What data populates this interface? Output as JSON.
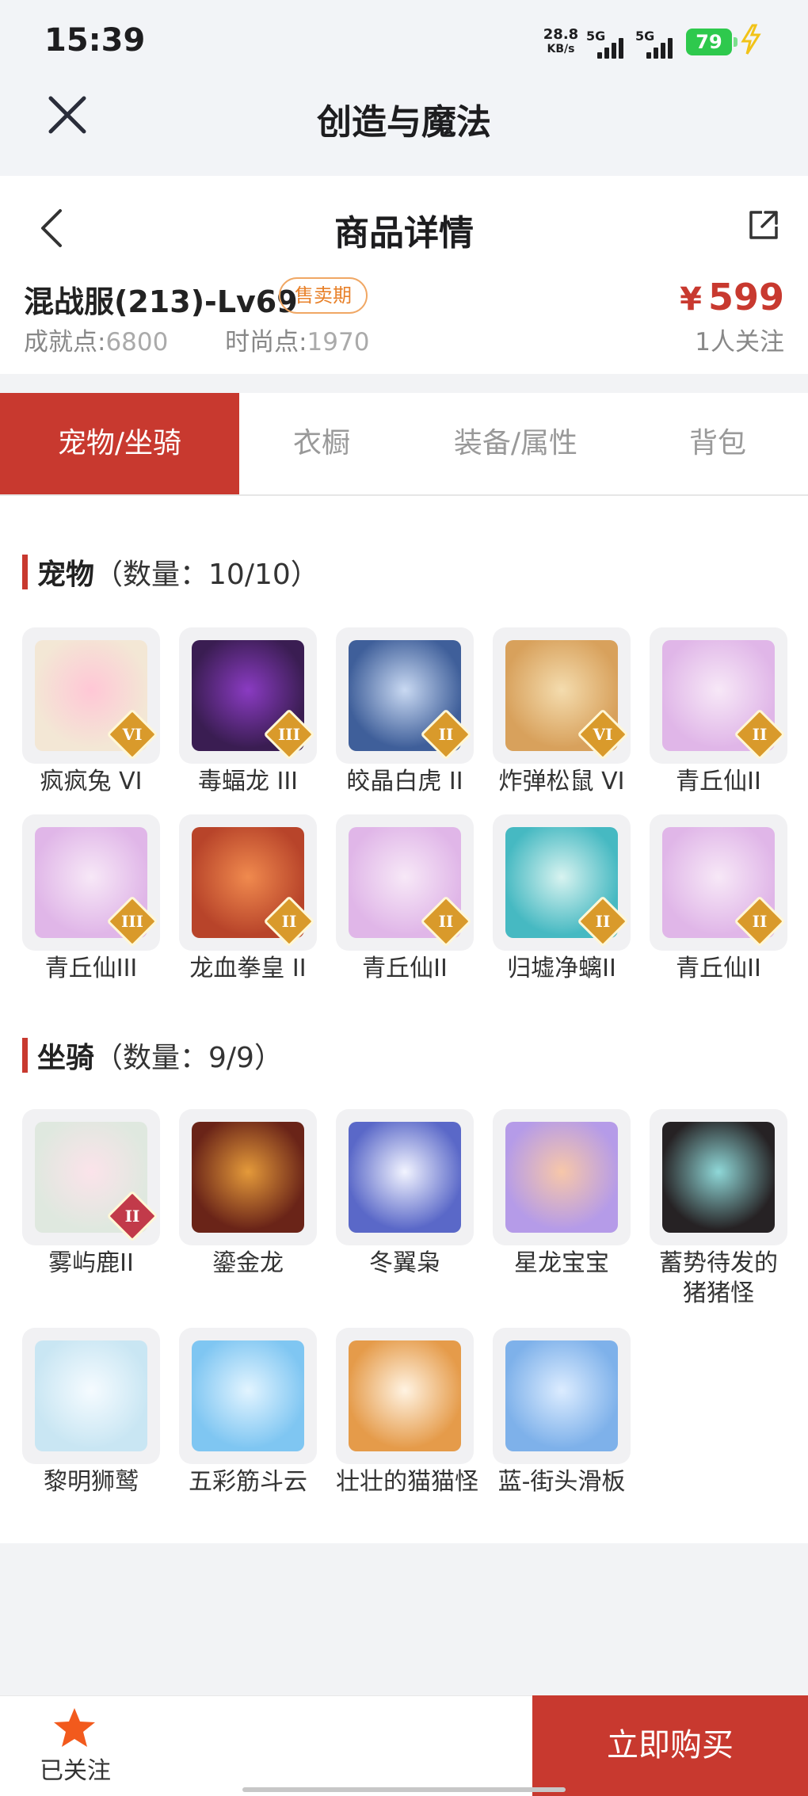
{
  "status_bar": {
    "time": "15:39",
    "net_speed_value": "28.8",
    "net_speed_unit": "KB/s",
    "signal1_label": "5G",
    "signal2_label": "5G",
    "battery": "79"
  },
  "app_bar": {
    "title": "创造与魔法"
  },
  "header": {
    "title": "商品详情"
  },
  "product": {
    "server": "混战服(213)-Lv69",
    "badge": "售卖期",
    "price_symbol": "¥",
    "price": "599",
    "followers": "1人关注",
    "achievement_label": "成就点:",
    "achievement_value": "6800",
    "fashion_label": "时尚点:",
    "fashion_value": "1970"
  },
  "tabs": [
    {
      "label": "宠物/坐骑",
      "active": true
    },
    {
      "label": "衣橱",
      "active": false
    },
    {
      "label": "装备/属性",
      "active": false
    },
    {
      "label": "背包",
      "active": false
    }
  ],
  "pets_section": {
    "title": "宠物",
    "count": "（数量：10/10）"
  },
  "pets": [
    {
      "name": "疯疯兔 VI",
      "level": "VI",
      "icon": "bunny-icon",
      "color": "#f3e7d5",
      "color2": "#ffc7d6"
    },
    {
      "name": "毒蝠龙 III",
      "level": "III",
      "icon": "bat-dragon-icon",
      "color": "#3a1d52",
      "color2": "#8a3bc2"
    },
    {
      "name": "皎晶白虎 II",
      "level": "II",
      "icon": "white-tiger-icon",
      "color": "#3f5f9a",
      "color2": "#c9d9f2"
    },
    {
      "name": "炸弹松鼠 VI",
      "level": "VI",
      "icon": "squirrel-icon",
      "color": "#d8a15c",
      "color2": "#f4dcae"
    },
    {
      "name": "青丘仙II",
      "level": "II",
      "icon": "fox-fairy-icon",
      "color": "#e0b6e8",
      "color2": "#f7e8f7"
    },
    {
      "name": "青丘仙III",
      "level": "III",
      "icon": "fox-fairy-icon",
      "color": "#e0b6e8",
      "color2": "#f7e8f7"
    },
    {
      "name": "龙血拳皇 II",
      "level": "II",
      "icon": "dragon-fist-icon",
      "color": "#b8442a",
      "color2": "#f08a4e"
    },
    {
      "name": "青丘仙II",
      "level": "II",
      "icon": "fox-fairy-icon",
      "color": "#e0b6e8",
      "color2": "#f7e8f7"
    },
    {
      "name": "归墟净螭II",
      "level": "II",
      "icon": "water-dragon-icon",
      "color": "#46b9c2",
      "color2": "#d8f3f0"
    },
    {
      "name": "青丘仙II",
      "level": "II",
      "icon": "fox-fairy-icon",
      "color": "#e0b6e8",
      "color2": "#f7e8f7"
    }
  ],
  "mounts_section": {
    "title": "坐骑",
    "count": "（数量：9/9）"
  },
  "mounts": [
    {
      "name": "雾屿鹿II",
      "level": "II",
      "icon": "deer-icon",
      "color": "#dfe8df",
      "color2": "#fbe3ea"
    },
    {
      "name": "鎏金龙",
      "level": "",
      "icon": "golden-dragon-icon",
      "color": "#6a2418",
      "color2": "#e49a3a"
    },
    {
      "name": "冬翼枭",
      "level": "",
      "icon": "owl-icon",
      "color": "#5a68c8",
      "color2": "#f2f4ff"
    },
    {
      "name": "星龙宝宝",
      "level": "",
      "icon": "baby-dragon-icon",
      "color": "#b59be8",
      "color2": "#f7c7a9"
    },
    {
      "name": "蓄势待发的猪猪怪",
      "level": "",
      "icon": "pig-icon",
      "color": "#262224",
      "color2": "#8fd8d8"
    },
    {
      "name": "黎明狮鹫",
      "level": "",
      "icon": "griffin-icon",
      "color": "#c9e6f3",
      "color2": "#f5fbff"
    },
    {
      "name": "五彩筋斗云",
      "level": "",
      "icon": "cloud-icon",
      "color": "#7fc6f2",
      "color2": "#e2f4ff"
    },
    {
      "name": "壮壮的猫猫怪",
      "level": "",
      "icon": "cat-icon",
      "color": "#e59b4a",
      "color2": "#fff3e2"
    },
    {
      "name": "蓝-街头滑板",
      "level": "",
      "icon": "skateboard-icon",
      "color": "#7eb1ea",
      "color2": "#dcecff"
    }
  ],
  "footer": {
    "follow_label": "已关注",
    "buy_label": "立即购买"
  },
  "colors": {
    "accent": "#c8392f",
    "badge": "#e8812a",
    "level_badge": "#d99a2b",
    "level_badge_red": "#c23a4a"
  }
}
